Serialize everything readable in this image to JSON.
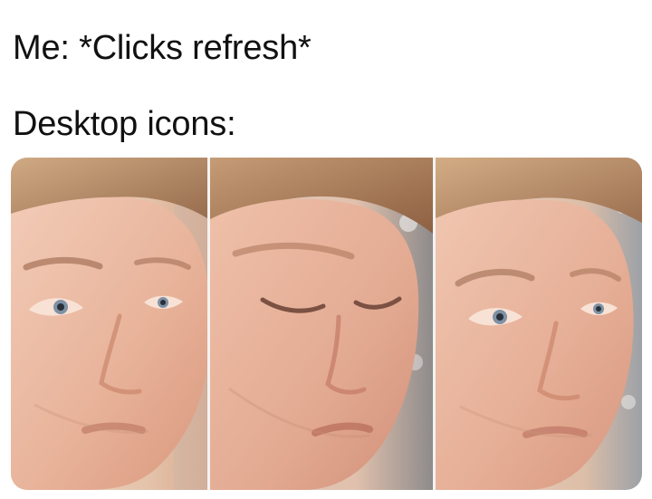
{
  "caption": {
    "line1": "Me: *Clicks refresh*",
    "line2": "Desktop icons:"
  },
  "panels": [
    {
      "name": "blinking-guy-frame-1",
      "state": "eyes-open-looking-left"
    },
    {
      "name": "blinking-guy-frame-2",
      "state": "eyes-closed-blinking"
    },
    {
      "name": "blinking-guy-frame-3",
      "state": "eyes-open-looking-left"
    }
  ],
  "colors": {
    "background": "#ffffff",
    "text": "#111111",
    "skin": "#e9b59c",
    "hair": "#b88a62"
  }
}
